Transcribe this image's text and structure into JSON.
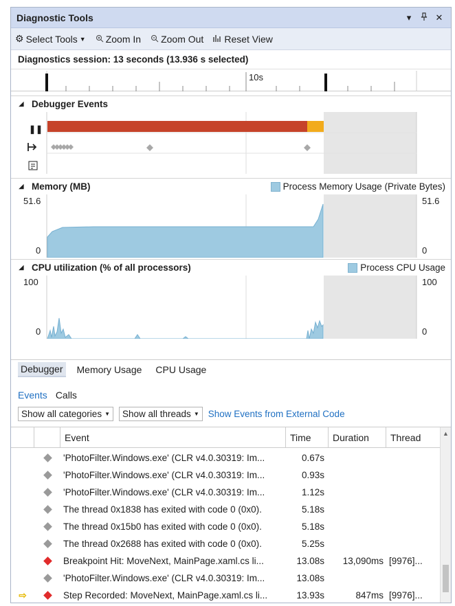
{
  "window": {
    "title": "Diagnostic Tools",
    "title_icons": [
      "▾",
      "ᵖ",
      "✕"
    ]
  },
  "toolbar": {
    "select_tools": "Select Tools",
    "zoom_in": "Zoom In",
    "zoom_out": "Zoom Out",
    "reset_view": "Reset View"
  },
  "session": {
    "text": "Diagnostics session: 13 seconds (13.936 s selected)"
  },
  "ruler": {
    "label_10s": "10s"
  },
  "debugger_events": {
    "title": "Debugger Events"
  },
  "memory": {
    "title": "Memory (MB)",
    "legend": "Process Memory Usage (Private Bytes)",
    "max_left": "51.6",
    "min_left": "0",
    "max_right": "51.6",
    "min_right": "0"
  },
  "cpu": {
    "title": "CPU utilization (% of all processors)",
    "legend": "Process CPU Usage",
    "max_left": "100",
    "min_left": "0",
    "max_right": "100",
    "min_right": "0"
  },
  "tabs": [
    "Debugger",
    "Memory Usage",
    "CPU Usage"
  ],
  "subtabs": [
    "Events",
    "Calls"
  ],
  "filters": {
    "categories": "Show all categories",
    "threads": "Show all threads",
    "external_link": "Show Events from External Code"
  },
  "grid": {
    "headers": {
      "event": "Event",
      "time": "Time",
      "duration": "Duration",
      "thread": "Thread"
    },
    "rows": [
      {
        "marker": "",
        "kind": "gray",
        "event": "'PhotoFilter.Windows.exe' (CLR v4.0.30319: Im...",
        "time": "0.67s",
        "duration": "",
        "thread": ""
      },
      {
        "marker": "",
        "kind": "gray",
        "event": "'PhotoFilter.Windows.exe' (CLR v4.0.30319: Im...",
        "time": "0.93s",
        "duration": "",
        "thread": ""
      },
      {
        "marker": "",
        "kind": "gray",
        "event": "'PhotoFilter.Windows.exe' (CLR v4.0.30319: Im...",
        "time": "1.12s",
        "duration": "",
        "thread": ""
      },
      {
        "marker": "",
        "kind": "gray",
        "event": "The thread 0x1838 has exited with code 0 (0x0).",
        "time": "5.18s",
        "duration": "",
        "thread": ""
      },
      {
        "marker": "",
        "kind": "gray",
        "event": "The thread 0x15b0 has exited with code 0 (0x0).",
        "time": "5.18s",
        "duration": "",
        "thread": ""
      },
      {
        "marker": "",
        "kind": "gray",
        "event": "The thread 0x2688 has exited with code 0 (0x0).",
        "time": "5.25s",
        "duration": "",
        "thread": ""
      },
      {
        "marker": "",
        "kind": "red",
        "event": "Breakpoint Hit: MoveNext, MainPage.xaml.cs li...",
        "time": "13.08s",
        "duration": "13,090ms",
        "thread": "[9976]..."
      },
      {
        "marker": "",
        "kind": "gray",
        "event": "'PhotoFilter.Windows.exe' (CLR v4.0.30319: Im...",
        "time": "13.08s",
        "duration": "",
        "thread": ""
      },
      {
        "marker": "⇨",
        "kind": "red",
        "event": "Step Recorded: MoveNext, MainPage.xaml.cs li...",
        "time": "13.93s",
        "duration": "847ms",
        "thread": "[9976]..."
      }
    ]
  }
}
